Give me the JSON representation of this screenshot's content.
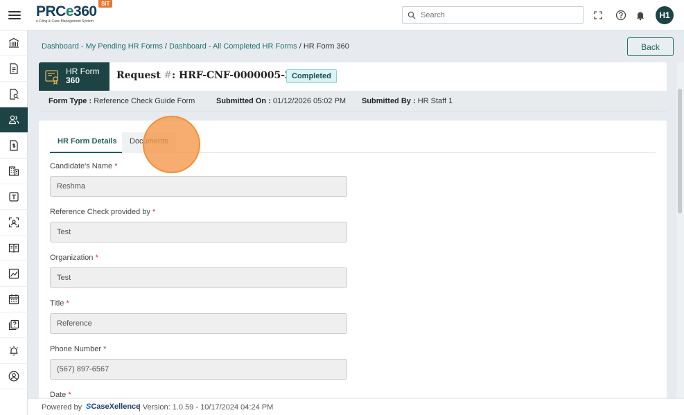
{
  "app": {
    "logo_main": "PRCe360",
    "logo_sub": "e-Filing & Case Management System",
    "env_badge": "SIT",
    "search_placeholder": "Search",
    "user_initials": "H1"
  },
  "sidebar": {
    "items": [
      {
        "name": "bank-icon",
        "active": false
      },
      {
        "name": "document-icon",
        "active": false
      },
      {
        "name": "document-search-icon",
        "active": false
      },
      {
        "name": "users-icon",
        "active": true
      },
      {
        "name": "dollar-document-icon",
        "active": false
      },
      {
        "name": "building-icon",
        "active": false
      },
      {
        "name": "text-box-icon",
        "active": false
      },
      {
        "name": "scan-user-icon",
        "active": false
      },
      {
        "name": "book-icon",
        "active": false
      },
      {
        "name": "chart-icon",
        "active": false
      },
      {
        "name": "calendar-icon",
        "active": false
      },
      {
        "name": "help-docs-icon",
        "active": false
      },
      {
        "name": "alarm-icon",
        "active": false
      },
      {
        "name": "user-circle-icon",
        "active": false
      }
    ]
  },
  "breadcrumb": {
    "link1": "Dashboard - My Pending HR Forms",
    "link2": "Dashboard - All Completed HR Forms",
    "current": "HR Form 360",
    "separator": "/"
  },
  "back_label": "Back",
  "header": {
    "tag_line1": "HR Form",
    "tag_line2": "360",
    "request_prefix": "Request",
    "request_hash": "#",
    "request_id": ": HRF-CNF-0000005-26",
    "status": "Completed"
  },
  "meta": {
    "form_type_label": "Form Type :",
    "form_type_value": "Reference Check Guide Form",
    "submitted_on_label": "Submitted On :",
    "submitted_on_value": "01/12/2026 05:02 PM",
    "submitted_by_label": "Submitted By :",
    "submitted_by_value": "HR Staff 1"
  },
  "tabs": [
    {
      "label": "HR Form Details",
      "active": true
    },
    {
      "label": "Documents",
      "active": false
    }
  ],
  "fields": [
    {
      "label": "Candidate's Name",
      "required": "*",
      "value": "Reshma"
    },
    {
      "label": "Reference Check provided by",
      "required": "*",
      "value": "Test"
    },
    {
      "label": "Organization",
      "required": "*",
      "value": "Test"
    },
    {
      "label": "Title",
      "required": "*",
      "value": "Reference"
    },
    {
      "label": "Phone Number",
      "required": "*",
      "value": "(567) 897-6567"
    },
    {
      "label": "Date",
      "required": "*",
      "value": ""
    }
  ],
  "footer": {
    "powered_by": "Powered by",
    "brand_s": "S",
    "brand_rest": "CaseXellence",
    "version": "|   Version: 1.0.59 - 10/17/2024 04:24 PM"
  },
  "colors": {
    "primary_dark": "#1d4345",
    "link_teal": "#1c7367",
    "badge_bg": "#daf3f4",
    "env_badge": "#e9752f",
    "required": "#d7263d"
  }
}
